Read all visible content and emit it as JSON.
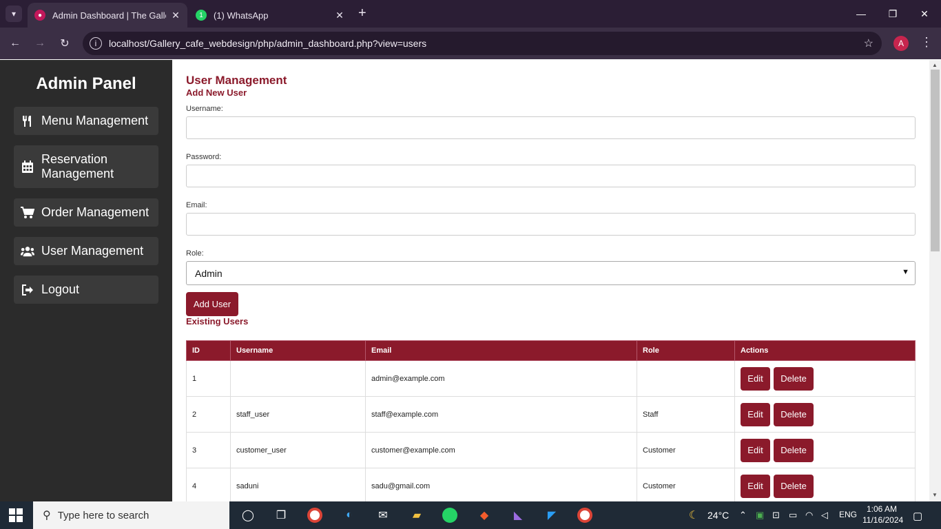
{
  "browser": {
    "tabs": [
      {
        "title": "Admin Dashboard | The Gallery",
        "active": true
      },
      {
        "title": "(1) WhatsApp",
        "active": false
      }
    ],
    "url": "localhost/Gallery_cafe_webdesign/php/admin_dashboard.php?view=users",
    "profile_initial": "A"
  },
  "sidebar": {
    "title": "Admin Panel",
    "items": [
      {
        "label": "Menu Management",
        "icon": "utensils-icon"
      },
      {
        "label": "Reservation Management",
        "icon": "calendar-icon"
      },
      {
        "label": "Order Management",
        "icon": "cart-icon"
      },
      {
        "label": "User Management",
        "icon": "users-icon"
      },
      {
        "label": "Logout",
        "icon": "logout-icon"
      }
    ]
  },
  "main": {
    "title": "User Management",
    "add_heading": "Add New User",
    "form": {
      "username_label": "Username:",
      "password_label": "Password:",
      "email_label": "Email:",
      "role_label": "Role:",
      "role_value": "Admin",
      "submit_label": "Add User"
    },
    "existing_heading": "Existing Users",
    "table": {
      "headers": [
        "ID",
        "Username",
        "Email",
        "Role",
        "Actions"
      ],
      "rows": [
        {
          "id": "1",
          "username": "",
          "email": "admin@example.com",
          "role": ""
        },
        {
          "id": "2",
          "username": "staff_user",
          "email": "staff@example.com",
          "role": "Staff"
        },
        {
          "id": "3",
          "username": "customer_user",
          "email": "customer@example.com",
          "role": "Customer"
        },
        {
          "id": "4",
          "username": "saduni",
          "email": "sadu@gmail.com",
          "role": "Customer"
        }
      ],
      "edit_label": "Edit",
      "delete_label": "Delete"
    }
  },
  "taskbar": {
    "search_placeholder": "Type here to search",
    "weather": "24°C",
    "language": "ENG",
    "time": "1:06 AM",
    "date": "11/16/2024"
  },
  "colors": {
    "accent": "#8b1a2b",
    "sidebar_bg": "#2b2b2b",
    "sidebar_btn": "#3a3a3a"
  }
}
